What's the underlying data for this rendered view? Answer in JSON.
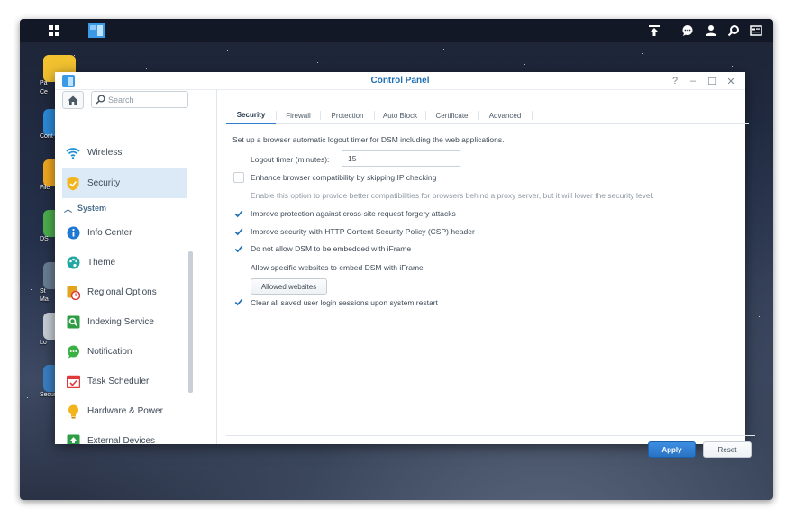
{
  "taskbar": {
    "main_menu_icon": "grid-icon",
    "control_panel_icon": "control-panel-icon",
    "upload_icon": "upload-icon",
    "notifications_icon": "chat-icon",
    "user_icon": "user-icon",
    "search_icon": "search-icon",
    "widgets_icon": "widgets-icon"
  },
  "desktop": {
    "icons": [
      {
        "label": "Pa",
        "label2": "Ce",
        "color": "#f2c230"
      },
      {
        "label": "Cont",
        "label2": "",
        "color": "#2c8ad8"
      },
      {
        "label": "File",
        "label2": "",
        "color": "#f0a820"
      },
      {
        "label": "DS",
        "label2": "",
        "color": "#4cae4c"
      },
      {
        "label": "St",
        "label2": "Ma",
        "color": "#6a7e94"
      },
      {
        "label": "Lo",
        "label2": "",
        "color": "#c8cfd6"
      },
      {
        "label": "Securi",
        "label2": "",
        "color": "#3a7fc2"
      }
    ]
  },
  "window": {
    "title": "Control Panel",
    "controls": {
      "help": "?",
      "minimize": "–",
      "maximize": "☐",
      "close": "✕"
    }
  },
  "sidebar": {
    "search_placeholder": "Search",
    "items_top": [
      {
        "label": "Wireless",
        "icon": "wifi-icon"
      },
      {
        "label": "Security",
        "icon": "shield-icon",
        "selected": true
      }
    ],
    "section_label": "System",
    "items": [
      {
        "label": "Info Center",
        "icon": "info-icon",
        "color": "#1f78d1"
      },
      {
        "label": "Theme",
        "icon": "palette-icon",
        "color": "#21a7a0"
      },
      {
        "label": "Regional Options",
        "icon": "clock-icon",
        "color": "#e3a31d"
      },
      {
        "label": "Indexing Service",
        "icon": "magnifier-icon",
        "color": "#2e9e44"
      },
      {
        "label": "Notification",
        "icon": "chat-bubble-icon",
        "color": "#3bb143"
      },
      {
        "label": "Task Scheduler",
        "icon": "calendar-check-icon",
        "color": "#e03a3a"
      },
      {
        "label": "Hardware & Power",
        "icon": "lightbulb-icon",
        "color": "#f2b51c"
      },
      {
        "label": "External Devices",
        "icon": "upload-box-icon",
        "color": "#2e9e44"
      }
    ]
  },
  "tabs": [
    {
      "label": "Security",
      "active": true
    },
    {
      "label": "Firewall"
    },
    {
      "label": "Protection"
    },
    {
      "label": "Auto Block"
    },
    {
      "label": "Certificate"
    },
    {
      "label": "Advanced"
    }
  ],
  "security": {
    "intro": "Set up a browser automatic logout timer for DSM including the web applications.",
    "logout_timer_label": "Logout timer (minutes):",
    "logout_timer_value": "15",
    "options": [
      {
        "label": "Enhance browser compatibility by skipping IP checking",
        "checked": false
      },
      {
        "label": "Improve protection against cross-site request forgery attacks",
        "checked": true
      },
      {
        "label": "Improve security with HTTP Content Security Policy (CSP) header",
        "checked": true
      },
      {
        "label": "Do not allow DSM to be embedded with iFrame",
        "checked": true
      },
      {
        "label": "Clear all saved user login sessions upon system restart",
        "checked": true
      }
    ],
    "compat_note": "Enable this option to provide better compatibilities for browsers behind a proxy server, but it will lower the security level.",
    "iframe_note": "Allow specific websites to embed DSM with iFrame",
    "allowed_websites_label": "Allowed websites"
  },
  "footer": {
    "apply_label": "Apply",
    "reset_label": "Reset"
  },
  "colors": {
    "accent": "#2e7bcf",
    "selected_bg": "#dceaf8",
    "check": "#1f6fb3"
  }
}
